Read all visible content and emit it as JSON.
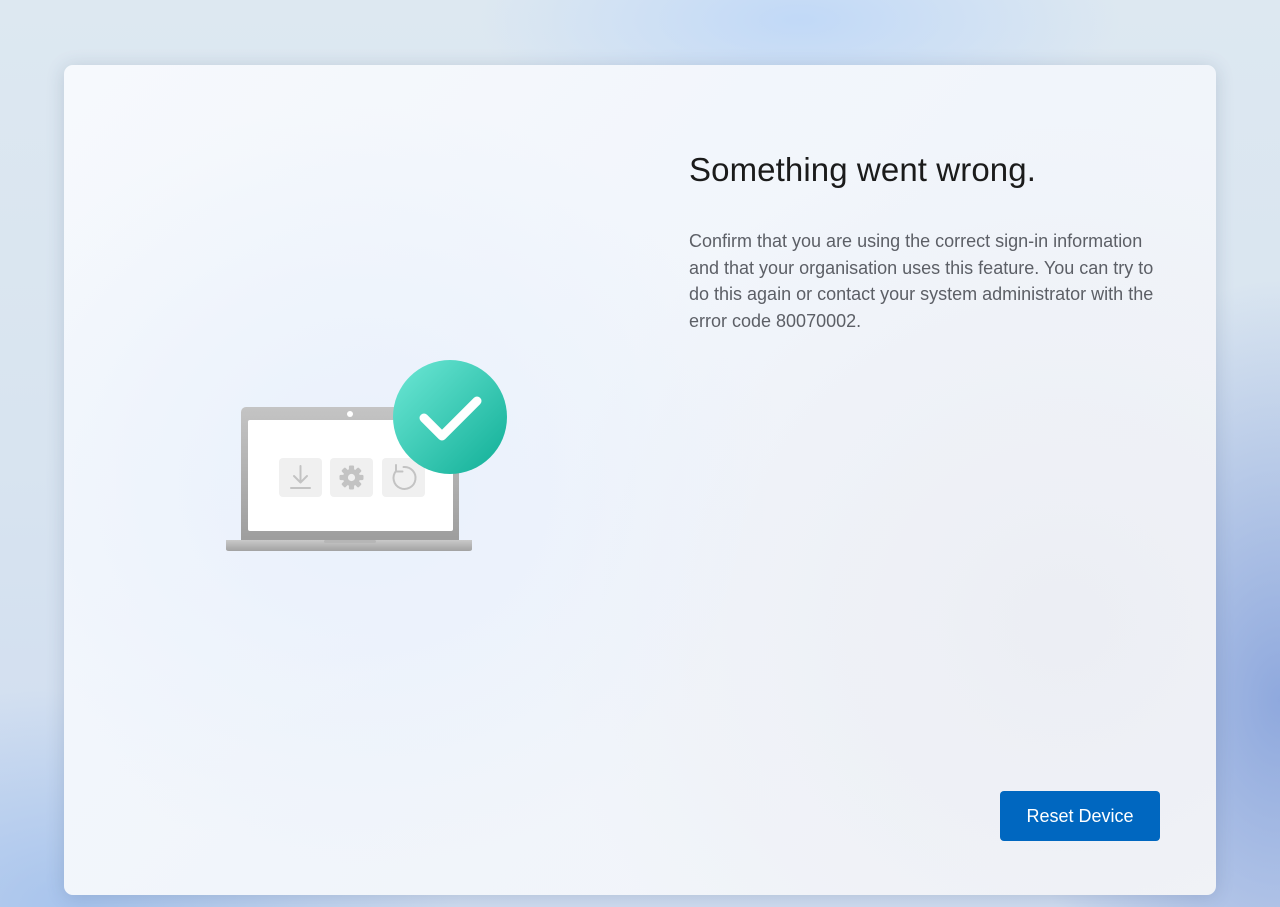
{
  "dialog": {
    "title": "Something went wrong.",
    "description": "Confirm that you are using the correct sign-in information and that your organisation uses this feature. You can try to do this again or contact your system administrator with the error code 80070002.",
    "primary_button_label": "Reset Device"
  },
  "illustration": {
    "icons": [
      "download-icon",
      "gear-icon",
      "refresh-icon",
      "checkmark-icon"
    ]
  },
  "colors": {
    "accent": "#0067c0",
    "success": "#1cc7a4",
    "title_text": "#1b1b1b",
    "body_text": "#5c5f66"
  }
}
